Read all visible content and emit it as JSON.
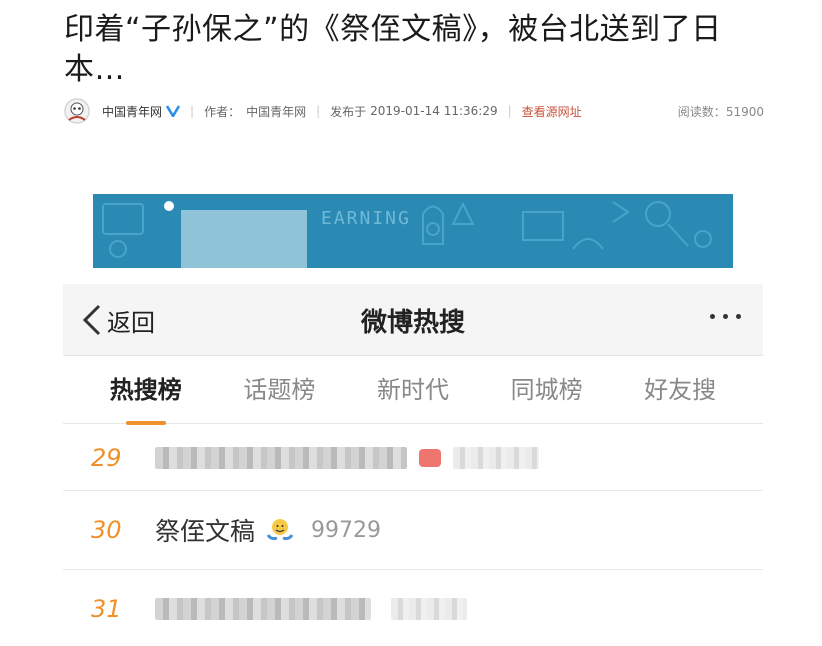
{
  "article": {
    "title": "印着“子孙保之”的《祭侄文稿》，被台北送到了日本…",
    "source_name": "中国青年网",
    "author_label": "作者：",
    "author": "中国青年网",
    "published_label": "发布于",
    "published": "2019-01-14 11:36:29",
    "source_link": "查看源网址",
    "read_label": "阅读数：",
    "read_count": "51900",
    "verified_color": "#2d8fe6",
    "link_color": "#c9533b"
  },
  "banner": {
    "text": "EARNING",
    "color": "#2a8ab4"
  },
  "weibo": {
    "back_label": "返回",
    "title": "微博热搜",
    "more_icon": "ellipsis-icon",
    "tabs": [
      {
        "label": "热搜榜",
        "active": true
      },
      {
        "label": "话题榜",
        "active": false
      },
      {
        "label": "新时代",
        "active": false
      },
      {
        "label": "同城榜",
        "active": false
      },
      {
        "label": "好友搜",
        "active": false
      }
    ],
    "accent_color": "#f0902a",
    "rows": [
      {
        "rank": "29",
        "topic": "",
        "hot": "",
        "blurred": true
      },
      {
        "rank": "30",
        "topic": "祭侄文稿",
        "hot": "99729",
        "emoji": "shrug-emoji-icon",
        "blurred": false
      },
      {
        "rank": "31",
        "topic": "",
        "hot": "",
        "blurred": true
      }
    ]
  }
}
